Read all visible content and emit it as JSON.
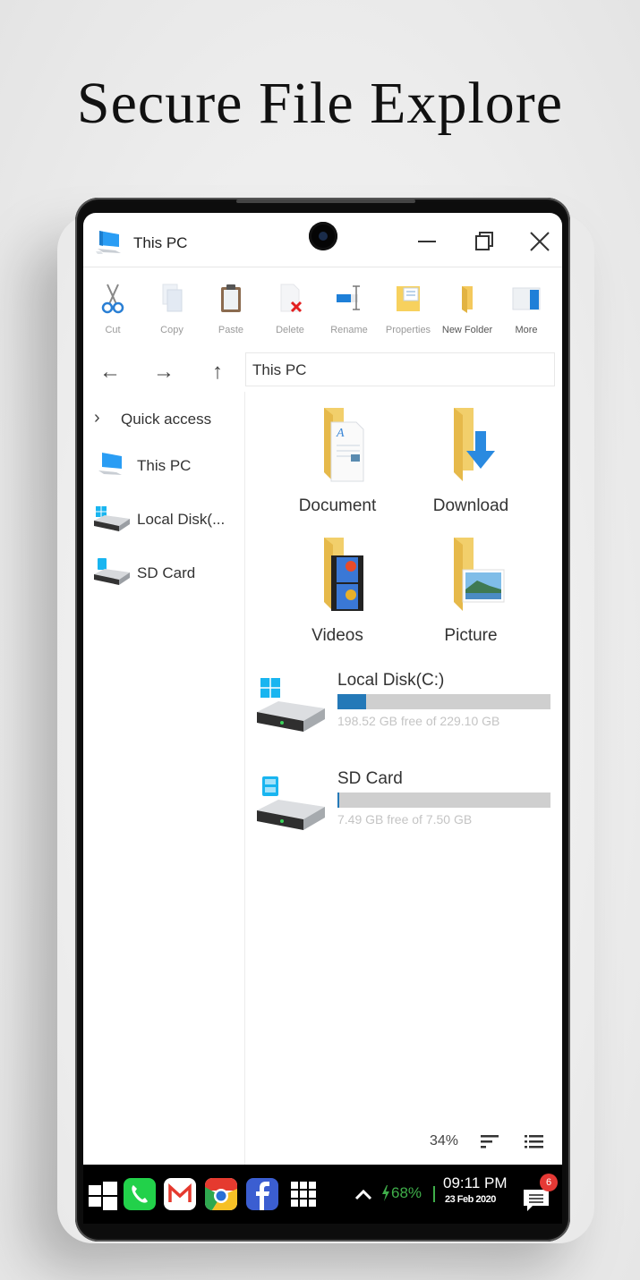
{
  "headline": "Secure File Explore",
  "window": {
    "title": "This PC",
    "controls": {
      "minimize": "minimize-icon",
      "maximize": "restore-icon",
      "close": "close-icon"
    }
  },
  "ribbon": [
    {
      "label": "Cut",
      "icon": "scissors-icon",
      "enabled": true
    },
    {
      "label": "Copy",
      "icon": "copy-icon",
      "enabled": false
    },
    {
      "label": "Paste",
      "icon": "clipboard-icon",
      "enabled": false
    },
    {
      "label": "Delete",
      "icon": "delete-icon",
      "enabled": false
    },
    {
      "label": "Rename",
      "icon": "rename-icon",
      "enabled": false
    },
    {
      "label": "Properties",
      "icon": "properties-icon",
      "enabled": false
    },
    {
      "label": "New Folder",
      "icon": "new-folder-icon",
      "enabled": true
    },
    {
      "label": "More",
      "icon": "more-panel-icon",
      "enabled": true
    }
  ],
  "nav": {
    "back": "←",
    "forward": "→",
    "up": "↑",
    "address": "This PC"
  },
  "sidebar": [
    {
      "label": "Quick access",
      "icon": "chevron-right-icon"
    },
    {
      "label": "This PC",
      "icon": "computer-icon"
    },
    {
      "label": "Local Disk(...",
      "icon": "windows-drive-icon"
    },
    {
      "label": "SD Card",
      "icon": "sd-card-drive-icon"
    }
  ],
  "folders": [
    {
      "label": "Document",
      "icon": "documents-folder-icon"
    },
    {
      "label": "Download",
      "icon": "downloads-folder-icon"
    },
    {
      "label": "Videos",
      "icon": "videos-folder-icon"
    },
    {
      "label": "Picture",
      "icon": "pictures-folder-icon"
    }
  ],
  "drives": [
    {
      "name": "Local Disk(C:)",
      "free_text": "198.52 GB free of 229.10 GB",
      "used_fraction": 0.133,
      "icon": "windows-drive-icon"
    },
    {
      "name": "SD Card",
      "free_text": "7.49 GB free of 7.50 GB",
      "used_fraction": 0.0013,
      "icon": "sd-card-drive-icon"
    }
  ],
  "statusbar": {
    "zoom": "34%",
    "sort_icon": "sort-icon",
    "view_icon": "list-view-icon"
  },
  "taskbar": {
    "apps": [
      "start-icon",
      "phone-icon",
      "gmail-icon",
      "chrome-icon",
      "facebook-icon",
      "apps-grid-icon"
    ],
    "battery": "68%",
    "time": "09:11 PM",
    "date": "23 Feb 2020",
    "notification_count": "6",
    "colors": {
      "battery": "#3fae4a",
      "badge": "#e53935"
    }
  }
}
